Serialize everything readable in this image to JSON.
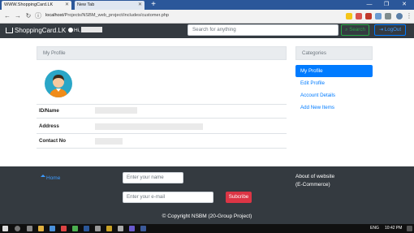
{
  "browser": {
    "tabs": [
      {
        "title": "WWW.ShoppingCard.LK",
        "active": true
      },
      {
        "title": "New Tab",
        "active": false
      }
    ],
    "new_tab_label": "+",
    "url_host": "localhost",
    "url_path": "/Projects/NSBM_web_project/includes/customer.php",
    "window_controls": [
      "—",
      "❐",
      "✕"
    ]
  },
  "navbar": {
    "brand": "ShoppingCard.LK",
    "greeting": "Hi,",
    "search_placeholder": "Search for anything",
    "search_label": "Search",
    "logout_label": "LogOut"
  },
  "profile": {
    "header": "My Profile",
    "rows": [
      {
        "label": "ID/Name"
      },
      {
        "label": "Address"
      },
      {
        "label": "Contact No"
      }
    ]
  },
  "categories": {
    "header": "Categories",
    "items": [
      {
        "label": "My Profile",
        "active": true
      },
      {
        "label": "Edit Profile",
        "active": false
      },
      {
        "label": "Account Details",
        "active": false
      },
      {
        "label": "Add New Items",
        "active": false
      }
    ]
  },
  "footer": {
    "home_label": "Home",
    "name_placeholder": "Enter your name",
    "email_placeholder": "Enter your e-mail",
    "subscribe_label": "Subcribe",
    "about_line1": "About of website",
    "about_line2": "(E-Commerce)",
    "copyright": "© Copyright NSBM (20-Group Project)"
  },
  "taskbar": {
    "language": "ENG",
    "time": "10:42 PM"
  },
  "colors": {
    "navbar_bg": "#343a40",
    "primary": "#007bff",
    "success": "#28a745",
    "danger": "#dc3545",
    "tabstrip": "#2b579a"
  }
}
